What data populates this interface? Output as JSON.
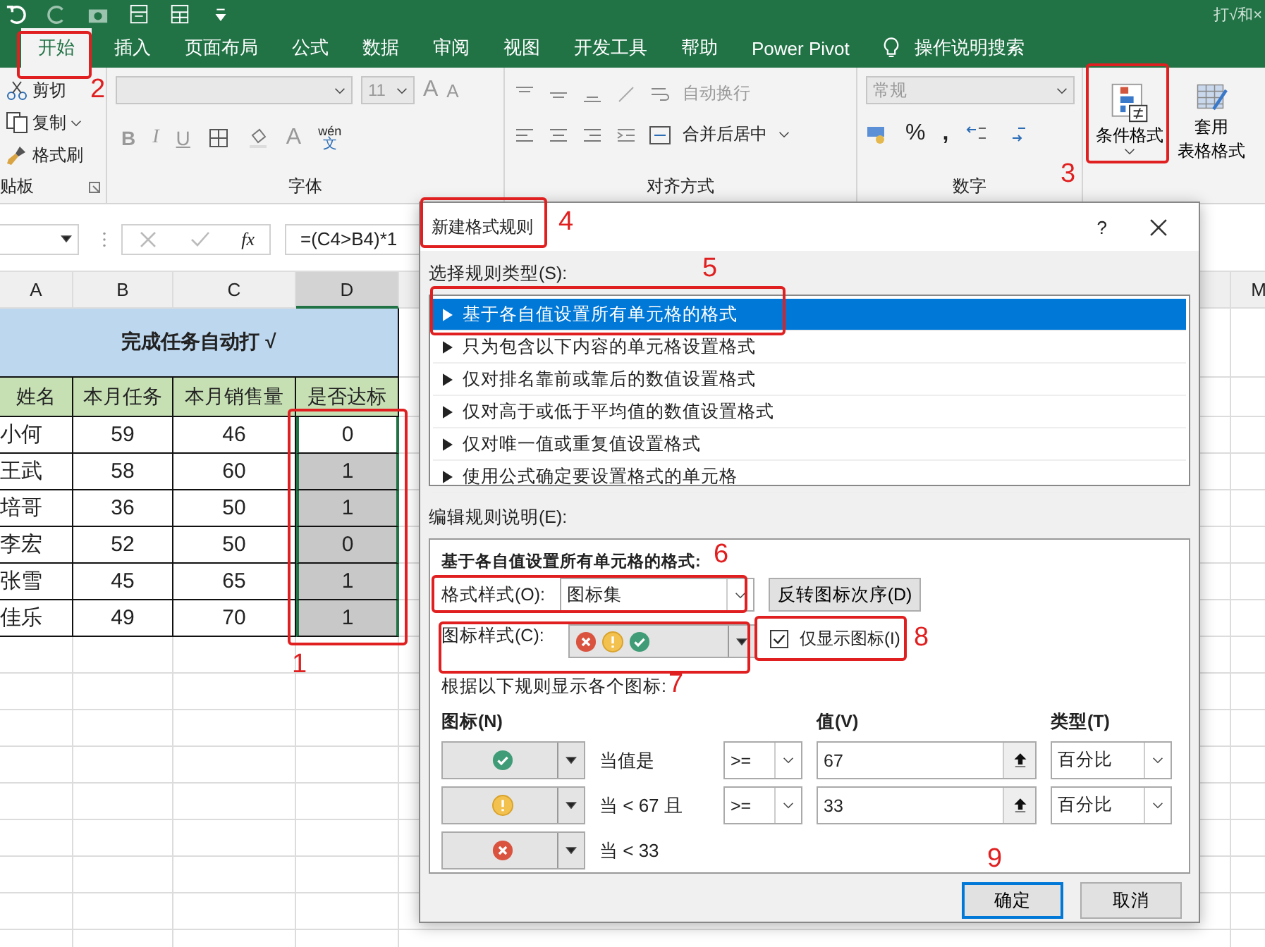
{
  "window": {
    "title": "打√和×"
  },
  "tabs": [
    {
      "label": "开始",
      "selected": true
    },
    {
      "label": "插入",
      "selected": false
    },
    {
      "label": "页面布局",
      "selected": false
    },
    {
      "label": "公式",
      "selected": false
    },
    {
      "label": "数据",
      "selected": false
    },
    {
      "label": "审阅",
      "selected": false
    },
    {
      "label": "视图",
      "selected": false
    },
    {
      "label": "开发工具",
      "selected": false
    },
    {
      "label": "帮助",
      "selected": false
    },
    {
      "label": "Power Pivot",
      "selected": false
    }
  ],
  "tell_me": "操作说明搜索",
  "ribbon": {
    "clipboard": {
      "label": "贴板",
      "cut": "剪切",
      "copy": "复制",
      "format_painter": "格式刷"
    },
    "font": {
      "label": "字体",
      "size": "11",
      "grow": "A",
      "shrink": "A",
      "bold": "B",
      "italic": "I",
      "underline": "U",
      "font_color": "A",
      "phonetic_top": "wén",
      "phonetic_bottom": "文"
    },
    "alignment": {
      "label": "对齐方式",
      "wrap_text": "自动换行",
      "merge_center": "合并后居中"
    },
    "number": {
      "label": "数字",
      "format": "常规",
      "percent": "%",
      "comma": ","
    },
    "styles": {
      "conditional_formatting": "条件格式",
      "format_as_table": [
        "套用",
        "表格格式"
      ]
    }
  },
  "formula_bar": {
    "function_label": "fx",
    "formula": "=(C4>B4)*1"
  },
  "sheet": {
    "columns": [
      {
        "label": "A",
        "selected": false
      },
      {
        "label": "B",
        "selected": false
      },
      {
        "label": "C",
        "selected": false
      },
      {
        "label": "D",
        "selected": true
      }
    ],
    "far_column": "M",
    "title": "完成任务自动打 √",
    "headers": [
      "姓名",
      "本月任务",
      "本月销售量",
      "是否达标"
    ],
    "rows": [
      {
        "name": "小何",
        "task": "59",
        "sales": "46",
        "met": "0",
        "active": true
      },
      {
        "name": "王武",
        "task": "58",
        "sales": "60",
        "met": "1",
        "active": false
      },
      {
        "name": "培哥",
        "task": "36",
        "sales": "50",
        "met": "1",
        "active": false
      },
      {
        "name": "李宏",
        "task": "52",
        "sales": "50",
        "met": "0",
        "active": false
      },
      {
        "name": "张雪",
        "task": "45",
        "sales": "65",
        "met": "1",
        "active": false
      },
      {
        "name": "佳乐",
        "task": "49",
        "sales": "70",
        "met": "1",
        "active": false
      }
    ]
  },
  "dialog": {
    "title": "新建格式规则",
    "help": "?",
    "rule_type_label": "选择规则类型(S):",
    "rule_types": [
      {
        "label": "基于各自值设置所有单元格的格式",
        "selected": true
      },
      {
        "label": "只为包含以下内容的单元格设置格式",
        "selected": false
      },
      {
        "label": "仅对排名靠前或靠后的数值设置格式",
        "selected": false
      },
      {
        "label": "仅对高于或低于平均值的数值设置格式",
        "selected": false
      },
      {
        "label": "仅对唯一值或重复值设置格式",
        "selected": false
      },
      {
        "label": "使用公式确定要设置格式的单元格",
        "selected": false
      }
    ],
    "edit_label": "编辑规则说明(E):",
    "description_heading": "基于各自值设置所有单元格的格式:",
    "format_style_label": "格式样式(O):",
    "format_style": "图标集",
    "reverse_button": "反转图标次序(D)",
    "icon_style_label": "图标样式(C):",
    "icon_style": [
      {
        "kind": "cross"
      },
      {
        "kind": "exclaim"
      },
      {
        "kind": "check"
      }
    ],
    "show_icon_only": {
      "label": "仅显示图标(I)",
      "checked": true
    },
    "rules_caption": "根据以下规则显示各个图标:",
    "rule_headers": {
      "icon": "图标(N)",
      "value": "值(V)",
      "type": "类型(T)"
    },
    "rules": [
      {
        "kind": "check",
        "condition": "当值是",
        "operator": ">=",
        "value": "67",
        "type": "百分比"
      },
      {
        "kind": "exclaim",
        "condition": "当 < 67 且",
        "operator": ">=",
        "value": "33",
        "type": "百分比"
      },
      {
        "kind": "cross",
        "condition": "当 < 33"
      }
    ],
    "ok_button": "确定",
    "cancel_button": "取消"
  },
  "annotations": [
    {
      "number": "1",
      "boxed": true
    },
    {
      "number": "2",
      "boxed": true
    },
    {
      "number": "3",
      "boxed": true
    },
    {
      "number": "4",
      "boxed": true
    },
    {
      "number": "5",
      "boxed": true
    },
    {
      "number": "6",
      "boxed": true
    },
    {
      "number": "7",
      "boxed": true
    },
    {
      "number": "8",
      "boxed": true
    },
    {
      "number": "9",
      "boxed": false
    }
  ]
}
